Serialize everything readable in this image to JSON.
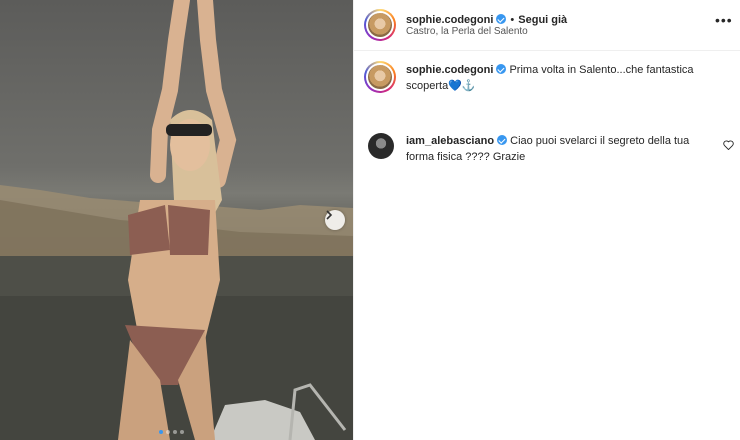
{
  "post": {
    "username": "sophie.codegoni",
    "follow_label": "Segui già",
    "separator": "•",
    "location": "Castro, la Perla del Salento",
    "more_icon": "more-horizontal-icon",
    "carousel": {
      "total_slides": 4,
      "current_slide": 1
    }
  },
  "caption": {
    "username": "sophie.codegoni",
    "text": "Prima volta in Salento...che fantastica scoperta💙⚓"
  },
  "comments": [
    {
      "username": "iam_alebasciano",
      "text": "Ciao puoi svelarci il segreto della tua forma fisica ???? Grazie"
    }
  ],
  "colors": {
    "verified": "#3897f0",
    "text": "#262626",
    "border": "#efefef"
  }
}
